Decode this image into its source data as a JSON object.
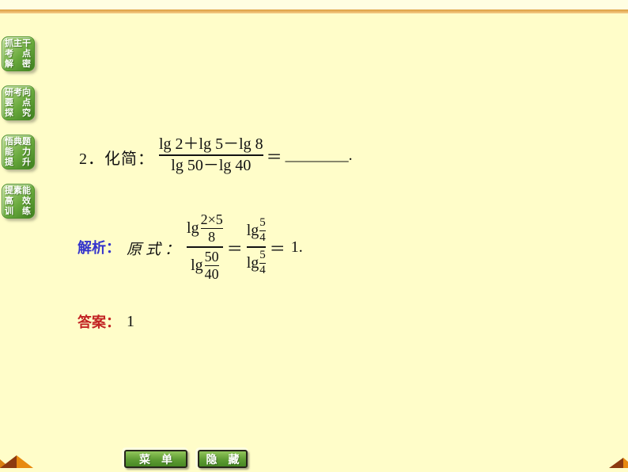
{
  "sidebar": {
    "buttons": [
      {
        "rows": [
          "抓主干",
          "考　点",
          "解　密"
        ]
      },
      {
        "rows": [
          "研考向",
          "要　点",
          "探　究"
        ]
      },
      {
        "rows": [
          "悟典题",
          "能　力",
          "提　升"
        ]
      },
      {
        "rows": [
          "提素能",
          "高　效",
          "训　练"
        ]
      }
    ]
  },
  "problem": {
    "label": "2．化简：",
    "frac": {
      "num": "lg 2＋lg 5－lg 8",
      "den": "lg 50－lg 40"
    },
    "equals": "＝",
    "blank": "________",
    "period": "."
  },
  "solution": {
    "tag": "解析：",
    "prefix": "原式：",
    "frac1": {
      "num_fn": "lg",
      "num_frac": {
        "num": "2×5",
        "den": "8"
      },
      "den_fn": "lg",
      "den_frac": {
        "num": "50",
        "den": "40"
      }
    },
    "eq1": "＝",
    "frac2": {
      "num_fn": "lg",
      "num_frac": {
        "num": "5",
        "den": "4"
      },
      "den_fn": "lg",
      "den_frac": {
        "num": "5",
        "den": "4"
      }
    },
    "eq2": "＝",
    "result": "1."
  },
  "answer": {
    "tag": "答案：",
    "value": "1"
  },
  "footer": {
    "menu": "菜　单",
    "hide": "隐　藏"
  },
  "colors": {
    "background": "#FFFDC9",
    "top_line_orange": "#E0A344",
    "button_green": "#5E9C33",
    "analysis_blue": "#3333CC",
    "answer_red": "#C22323",
    "corner_orange": "#E8890F",
    "corner_brown": "#8C3A10"
  }
}
